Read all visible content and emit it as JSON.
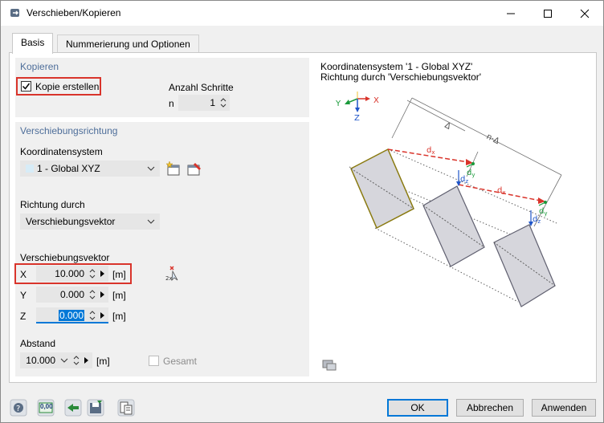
{
  "window": {
    "title": "Verschieben/Kopieren"
  },
  "tabs": [
    {
      "label": "Basis",
      "active": true
    },
    {
      "label": "Nummerierung und Optionen",
      "active": false
    }
  ],
  "kopieren": {
    "title": "Kopieren",
    "kopie_label": "Kopie erstellen",
    "kopie_checked": true,
    "anzahl_label": "Anzahl Schritte",
    "n_label": "n",
    "n_value": "1"
  },
  "richtung": {
    "title": "Verschiebungsrichtung",
    "koord_label": "Koordinatensystem",
    "koord_value": "1 - Global XYZ",
    "richtung_label": "Richtung durch",
    "richtung_value": "Verschiebungsvektor",
    "vektor_label": "Verschiebungsvektor",
    "x_label": "X",
    "x_value": "10.000",
    "y_label": "Y",
    "y_value": "0.000",
    "z_label": "Z",
    "z_value": "0.000",
    "unit": "[m]",
    "abstand_label": "Abstand",
    "abstand_value": "10.000",
    "abstand_unit": "[m]",
    "gesamt_label": "Gesamt"
  },
  "diagram": {
    "line1": "Koordinatensystem '1 - Global XYZ'",
    "line2": "Richtung durch 'Verschiebungsvektor'",
    "axis_x": "X",
    "axis_y": "Y",
    "axis_z": "Z",
    "delta": "Δ",
    "n_delta": "n·Δ",
    "dx": "d",
    "dx_sub": "x",
    "dy": "d",
    "dy_sub": "y",
    "dz": "d",
    "dz_sub": "z"
  },
  "footer": {
    "units_icon_text": "0,00",
    "ok": "OK",
    "cancel": "Abbrechen",
    "apply": "Anwenden"
  },
  "colors": {
    "accent": "#0078d7",
    "group_title": "#4e6e9a",
    "highlight": "#d9342b",
    "selected_text_bg": "#0078d7"
  }
}
